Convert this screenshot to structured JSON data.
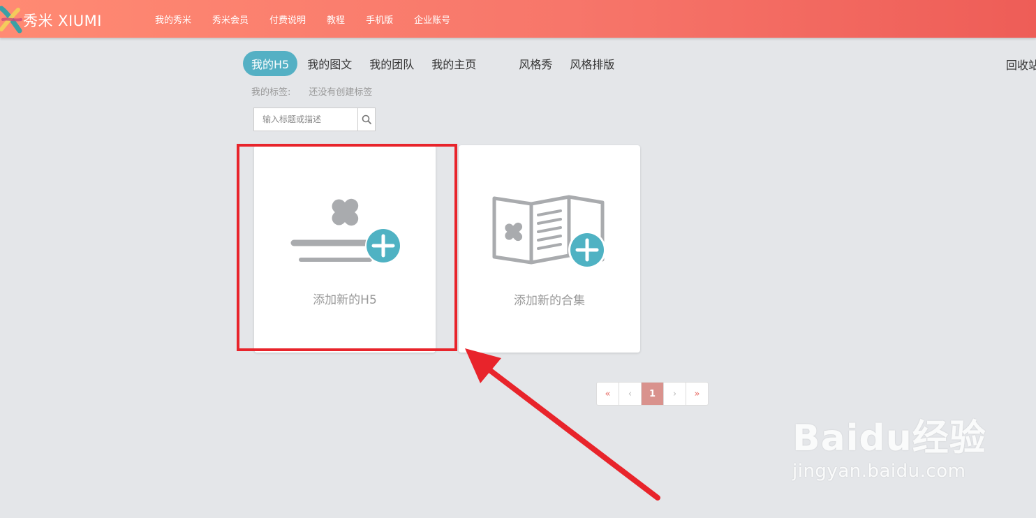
{
  "header": {
    "brand": "秀米 XIUMI",
    "nav": [
      "我的秀米",
      "秀米会员",
      "付费说明",
      "教程",
      "手机版",
      "企业账号"
    ]
  },
  "tabs": {
    "items": [
      "我的H5",
      "我的图文",
      "我的团队",
      "我的主页",
      "风格秀",
      "风格排版"
    ],
    "active": "我的H5",
    "recycle": "回收站"
  },
  "tags": {
    "label": "我的标签:",
    "empty": "还没有创建标签"
  },
  "search": {
    "placeholder": "输入标题或描述"
  },
  "cards": {
    "add_h5": "添加新的H5",
    "add_collection": "添加新的合集"
  },
  "pagination": {
    "first": "«",
    "prev": "‹",
    "current": "1",
    "next": "›",
    "last": "»"
  },
  "watermark": {
    "main": "Baidu经验",
    "sub": "jingyan.baidu.com"
  },
  "colors": {
    "header_start": "#ff8a73",
    "header_end": "#ee5d57",
    "accent_teal": "#54b0c4",
    "highlight_red": "#e8242b",
    "icon_gray": "#a9abae"
  }
}
